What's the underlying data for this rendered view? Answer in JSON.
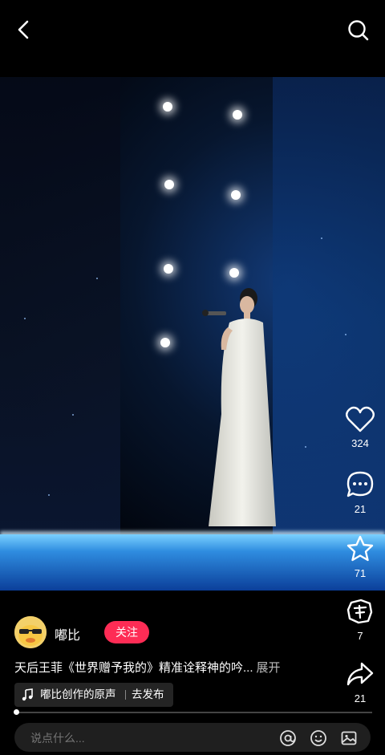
{
  "video": {
    "description_text": ""
  },
  "actions": {
    "like_count": "324",
    "comment_count": "21",
    "favorite_count": "71",
    "share_alt_count": "7",
    "forward_count": "21"
  },
  "author": {
    "name": "嘟比",
    "follow_label": "关注"
  },
  "caption": {
    "text": "天后王菲《世界赠予我的》精准诠释神的吟...",
    "more_label": "展开"
  },
  "music": {
    "label": "嘟比创作的原声",
    "publish_label": "去发布"
  },
  "progress": {
    "played_fraction": 0.005
  },
  "comment": {
    "placeholder": "说点什么..."
  },
  "colors": {
    "accent": "#fe2c55",
    "background": "#000000"
  },
  "icons": {
    "back": "chevron-left-icon",
    "search": "search-icon",
    "like": "heart-icon",
    "comment": "comment-icon",
    "favorite": "star-icon",
    "share_alt": "sticker-icon",
    "forward": "share-icon",
    "music": "music-note-icon",
    "mention": "at-icon",
    "emoji": "emoji-icon",
    "image": "image-icon"
  }
}
